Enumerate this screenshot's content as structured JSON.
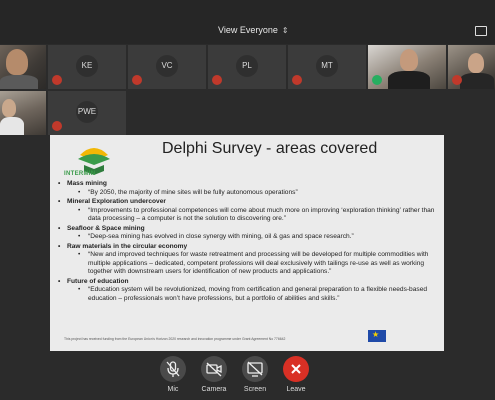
{
  "toolbar": {
    "view_label": "View Everyone"
  },
  "participants": [
    {
      "initials": "KE"
    },
    {
      "initials": "VC"
    },
    {
      "initials": "PL"
    },
    {
      "initials": "MT"
    },
    {
      "initials": "PWE"
    }
  ],
  "slide": {
    "logo_text": "INTERMIN",
    "title": "Delphi Survey - areas covered",
    "sections": [
      {
        "heading": "Mass mining",
        "detail": "“By 2050, the majority of mine sites will be fully autonomous operations”"
      },
      {
        "heading": "Mineral Exploration undercover",
        "detail": "“Improvements to professional competences will come about much more on improving ‘exploration thinking’ rather than data processing – a computer is not the solution to discovering ore.”"
      },
      {
        "heading": "Seafloor & Space mining",
        "detail": "“Deep-sea mining has evolved in close synergy with mining, oil & gas and space research.”"
      },
      {
        "heading": "Raw materials in the circular economy",
        "detail": "“New and improved techniques for waste retreatment and processing will be developed for multiple commodities with multiple applications – dedicated, competent professions will deal exclusively with tailings re-use as well as working together with downstream users for identification of new products and applications.”"
      },
      {
        "heading": "Future of education",
        "detail": "“Education system will be revolutionized, moving from certification and general preparation to a flexible needs-based education – professionals won’t have professions, but a portfolio of abilities and skills.”"
      }
    ],
    "funding_note": "This project has received funding from the European Union's Horizon 2020 research and innovation programme under Grant Agreement No 776642"
  },
  "controls": {
    "mic": "Mic",
    "camera": "Camera",
    "screen": "Screen",
    "leave": "Leave"
  },
  "icons": {
    "mic": "mic-off-icon",
    "camera": "camera-off-icon",
    "screen": "screen-share-icon",
    "leave": "close-icon",
    "view": "chevron-updown-icon",
    "cast": "cast-icon"
  },
  "colors": {
    "leave": "#d93025",
    "mute": "#c0392b",
    "speaking": "#27ae60",
    "logo": "#3a9b4a"
  }
}
